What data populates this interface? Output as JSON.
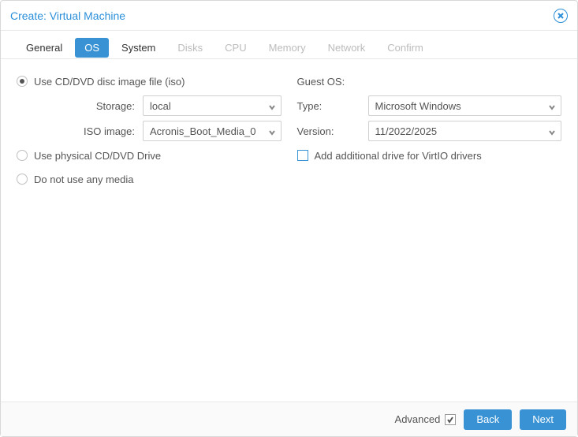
{
  "window": {
    "title": "Create: Virtual Machine"
  },
  "tabs": {
    "general": "General",
    "os": "OS",
    "system": "System",
    "disks": "Disks",
    "cpu": "CPU",
    "memory": "Memory",
    "network": "Network",
    "confirm": "Confirm",
    "active": "os",
    "disabled": [
      "disks",
      "cpu",
      "memory",
      "network",
      "confirm"
    ]
  },
  "media": {
    "use_iso_label": "Use CD/DVD disc image file (iso)",
    "storage_label": "Storage:",
    "storage_value": "local",
    "iso_label": "ISO image:",
    "iso_value": "Acronis_Boot_Media_0",
    "use_physical_label": "Use physical CD/DVD Drive",
    "no_media_label": "Do not use any media",
    "selected": "iso"
  },
  "guest": {
    "heading": "Guest OS:",
    "type_label": "Type:",
    "type_value": "Microsoft Windows",
    "version_label": "Version:",
    "version_value": "11/2022/2025",
    "virtio_label": "Add additional drive for VirtIO drivers",
    "virtio_checked": false
  },
  "footer": {
    "advanced_label": "Advanced",
    "advanced_checked": true,
    "back": "Back",
    "next": "Next"
  }
}
